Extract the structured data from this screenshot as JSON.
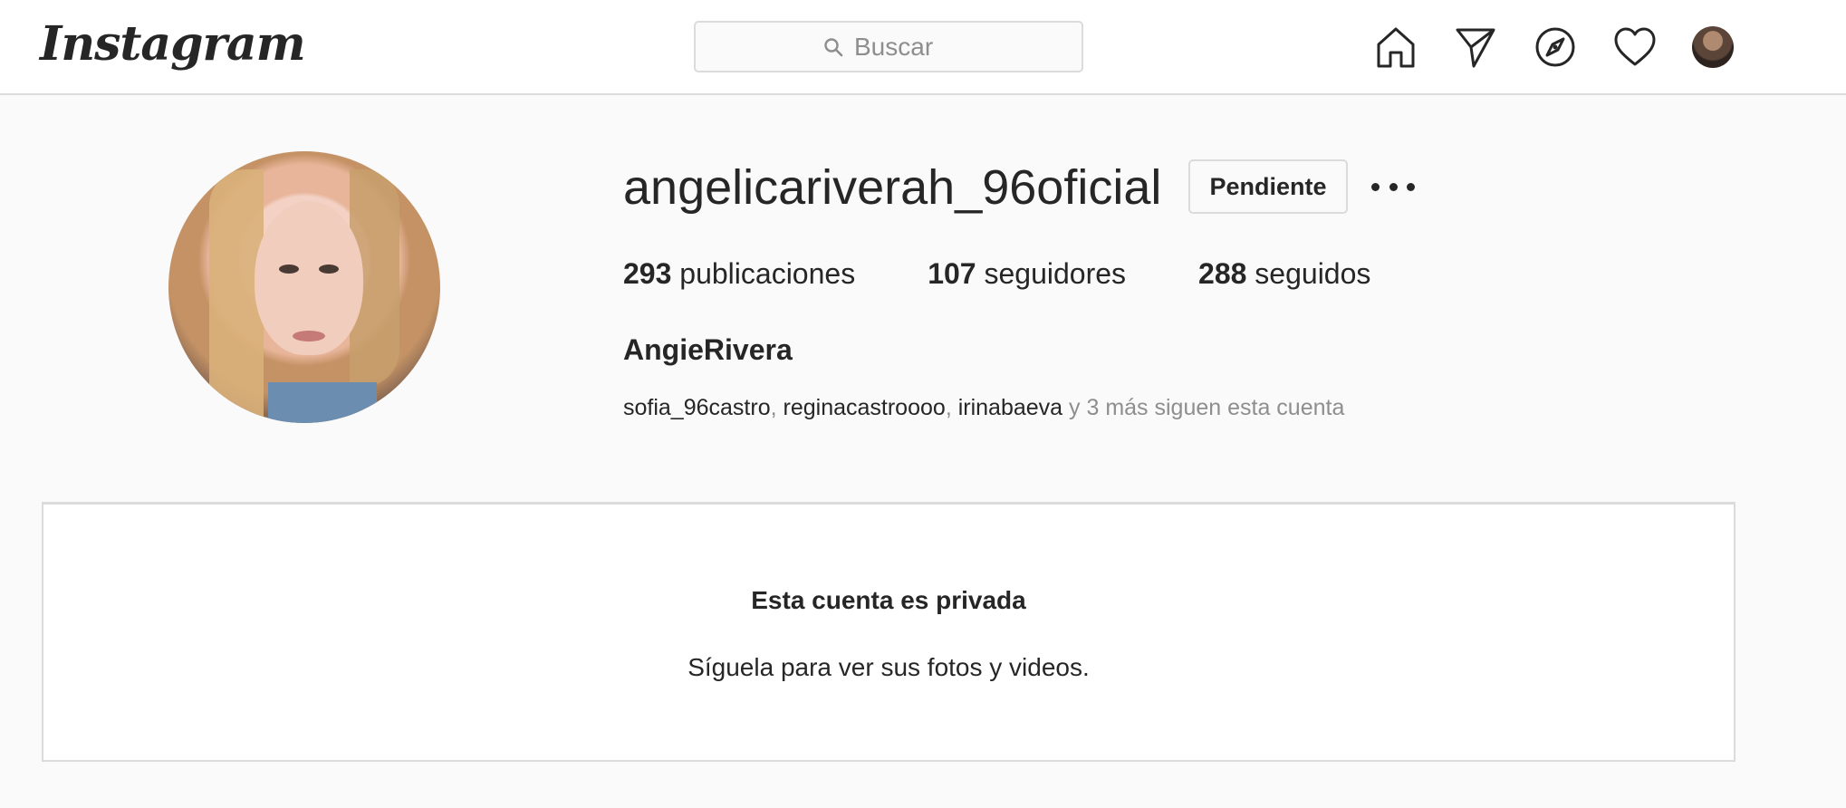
{
  "nav": {
    "logo_text": "Instagram",
    "search_placeholder": "Buscar",
    "icons": [
      "home-icon",
      "direct-icon",
      "explore-icon",
      "activity-icon",
      "profile-avatar"
    ]
  },
  "profile": {
    "username": "angelicariverah_96oficial",
    "pending_label": "Pendiente",
    "stats": [
      {
        "count": "293",
        "label": "publicaciones"
      },
      {
        "count": "107",
        "label": "seguidores"
      },
      {
        "count": "288",
        "label": "seguidos"
      }
    ],
    "full_name": "AngieRivera",
    "followed_by": {
      "accounts": [
        "sofia_96castro",
        "reginacastroooo",
        "irinabaeva"
      ],
      "separator": ", ",
      "suffix": " y 3 más siguen esta cuenta"
    }
  },
  "private": {
    "title": "Esta cuenta es privada",
    "subtitle": "Síguela para ver sus fotos y videos."
  },
  "colors": {
    "border": "#dbdbdb",
    "background": "#fafafa",
    "text": "#262626",
    "muted": "#8e8e8e"
  }
}
